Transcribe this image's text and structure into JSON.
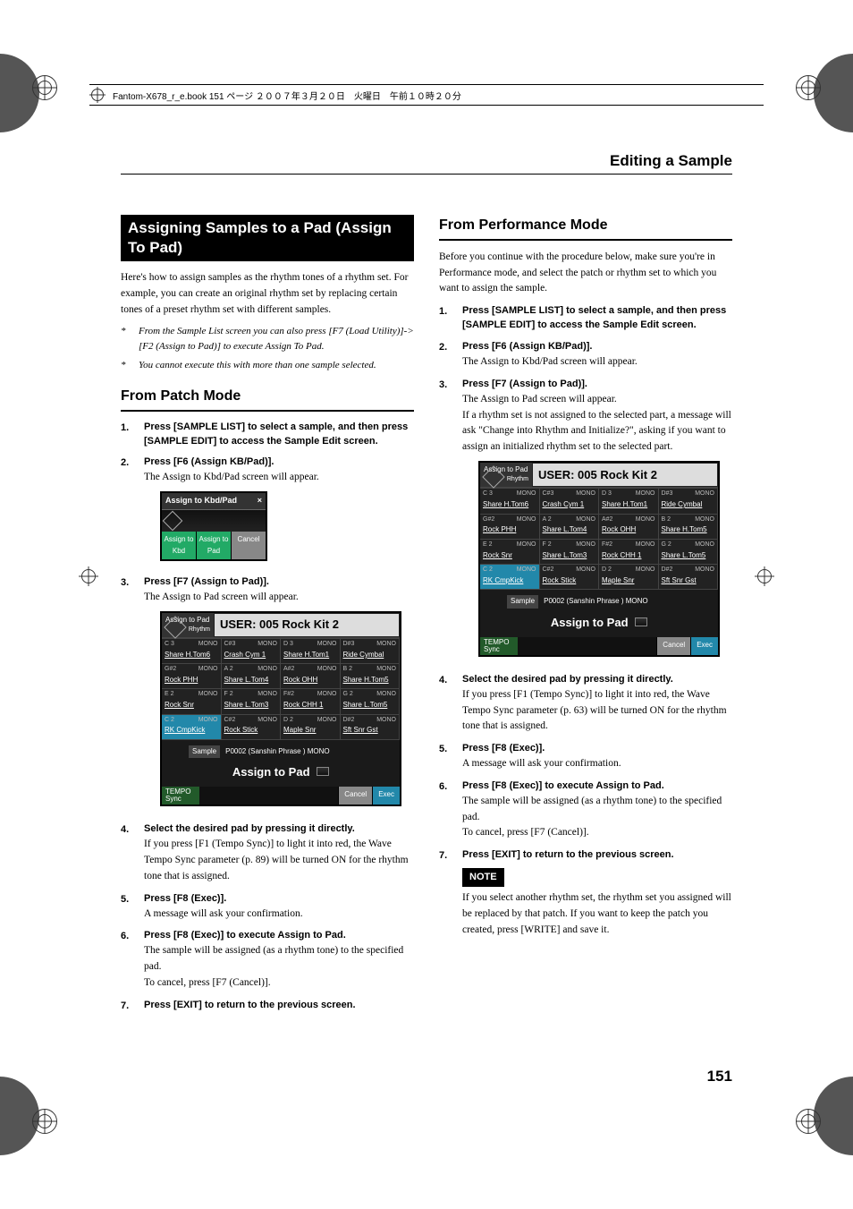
{
  "book_header": "Fantom-X678_r_e.book  151 ページ  ２００７年３月２０日　火曜日　午前１０時２０分",
  "page_heading": "Editing a Sample",
  "page_number": "151",
  "title_block": "Assigning Samples to a Pad (Assign To Pad)",
  "intro": "Here's how to assign samples as the rhythm tones of a rhythm set. For example, you can create an original rhythm set by replacing certain tones of a preset rhythm set with different samples.",
  "star_notes": [
    "From the Sample List screen you can also press [F7 (Load Utility)]-> [F2 (Assign to Pad)] to execute Assign To Pad.",
    "You cannot execute this with more than one sample selected."
  ],
  "patch": {
    "heading": "From Patch Mode",
    "steps": [
      {
        "num": "1.",
        "head": "Press [SAMPLE LIST] to select a sample, and then press [SAMPLE EDIT] to access the Sample Edit screen.",
        "body": ""
      },
      {
        "num": "2.",
        "head": "Press [F6 (Assign KB/Pad)].",
        "body": "The Assign to Kbd/Pad screen will appear."
      },
      {
        "num": "3.",
        "head": "Press [F7 (Assign to Pad)].",
        "body": "The Assign to Pad screen will appear."
      },
      {
        "num": "4.",
        "head": "Select the desired pad by pressing it directly.",
        "body": "If you press [F1 (Tempo Sync)] to light it into red, the Wave Tempo Sync parameter (p. 89) will be turned ON for the rhythm tone that is assigned."
      },
      {
        "num": "5.",
        "head": "Press [F8 (Exec)].",
        "body": "A message will ask your confirmation."
      },
      {
        "num": "6.",
        "head": "Press [F8 (Exec)] to execute Assign to Pad.",
        "body": "The sample will be assigned (as a rhythm tone) to the specified pad.",
        "body2": "To cancel, press [F7 (Cancel)]."
      },
      {
        "num": "7.",
        "head": "Press [EXIT] to return to the previous screen.",
        "body": ""
      }
    ]
  },
  "perf": {
    "heading": "From Performance Mode",
    "intro": "Before you continue with the procedure below, make sure you're in Performance mode, and select the patch or rhythm set to which you want to assign the sample.",
    "steps": [
      {
        "num": "1.",
        "head": "Press [SAMPLE LIST] to select a sample, and then press [SAMPLE EDIT] to access the Sample Edit screen.",
        "body": ""
      },
      {
        "num": "2.",
        "head": "Press [F6 (Assign KB/Pad)].",
        "body": "The Assign to Kbd/Pad screen will appear."
      },
      {
        "num": "3.",
        "head": "Press [F7 (Assign to Pad)].",
        "body": "The Assign to Pad screen will appear.",
        "body2": "If a rhythm set is not assigned to the selected part, a message will ask \"Change into Rhythm and Initialize?\", asking if you want to assign an initialized rhythm set to the selected part."
      },
      {
        "num": "4.",
        "head": "Select the desired pad by pressing it directly.",
        "body": "If you press [F1 (Tempo Sync)] to light it into red, the Wave Tempo Sync parameter (p. 63) will be turned ON for the rhythm tone that is assigned."
      },
      {
        "num": "5.",
        "head": "Press [F8 (Exec)].",
        "body": "A message will ask your confirmation."
      },
      {
        "num": "6.",
        "head": "Press [F8 (Exec)] to execute Assign to Pad.",
        "body": "The sample will be assigned (as a rhythm tone) to the specified pad.",
        "body2": "To cancel, press [F7 (Cancel)]."
      },
      {
        "num": "7.",
        "head": "Press [EXIT] to return to the previous screen.",
        "body": ""
      }
    ],
    "note_label": "NOTE",
    "note_body": "If you select another rhythm set, the rhythm set you assigned will be replaced by that patch. If you want to keep the patch you created, press [WRITE] and save it."
  },
  "kbd_shot": {
    "title": "Assign to Kbd/Pad",
    "btns": [
      "Assign to Kbd",
      "Assign to Pad",
      "Cancel"
    ]
  },
  "pad_shot": {
    "hdr_left_top": "Assign to Pad",
    "hdr_left_type": "Rhythm",
    "hdr_right": "USER: 005 Rock Kit 2",
    "cells": [
      {
        "nn": "C 3",
        "mono": "MONO",
        "lbl": "Share H.Tom6"
      },
      {
        "nn": "C#3",
        "mono": "MONO",
        "lbl": "Crash Cym 1"
      },
      {
        "nn": "D 3",
        "mono": "MONO",
        "lbl": "Share H.Tom1"
      },
      {
        "nn": "D#3",
        "mono": "MONO",
        "lbl": "Ride Cymbal"
      },
      {
        "nn": "G#2",
        "mono": "MONO",
        "lbl": "Rock PHH"
      },
      {
        "nn": "A 2",
        "mono": "MONO",
        "lbl": "Share L.Tom4"
      },
      {
        "nn": "A#2",
        "mono": "MONO",
        "lbl": "Rock OHH"
      },
      {
        "nn": "B 2",
        "mono": "MONO",
        "lbl": "Share H.Tom5"
      },
      {
        "nn": "E 2",
        "mono": "MONO",
        "lbl": "Rock Snr"
      },
      {
        "nn": "F 2",
        "mono": "MONO",
        "lbl": "Share L.Tom3"
      },
      {
        "nn": "F#2",
        "mono": "MONO",
        "lbl": "Rock CHH 1"
      },
      {
        "nn": "G 2",
        "mono": "MONO",
        "lbl": "Share L.Tom5"
      },
      {
        "nn": "C 2",
        "mono": "MONO",
        "lbl": "RK CmpKick",
        "sel": true
      },
      {
        "nn": "C#2",
        "mono": "MONO",
        "lbl": "Rock Stick"
      },
      {
        "nn": "D 2",
        "mono": "MONO",
        "lbl": "Maple Snr"
      },
      {
        "nn": "D#2",
        "mono": "MONO",
        "lbl": "Sft Snr Gst"
      }
    ],
    "sample_tag": "Sample",
    "sample_text": "P0002 (Sanshin Phrase  ) MONO",
    "bigtext": "Assign to Pad",
    "foot_tempo": "TEMPO Sync",
    "foot_cancel": "Cancel",
    "foot_exec": "Exec"
  }
}
